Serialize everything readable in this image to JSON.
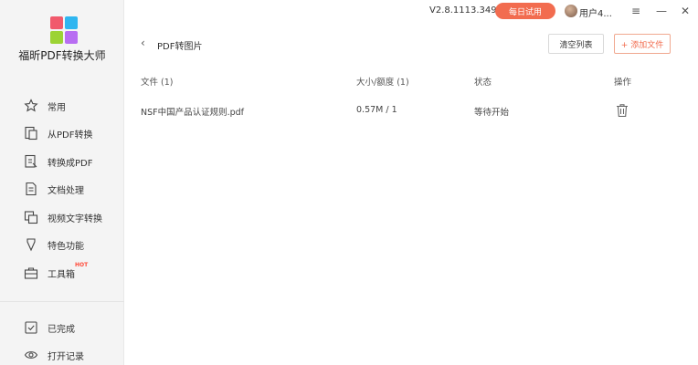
{
  "app": {
    "brand": "福昕PDF转换大师",
    "version": "V2.8.1113.349",
    "trial_button": "每日试用",
    "user_name": "用户4..."
  },
  "window_controls": {
    "menu": "≡",
    "minimize": "—",
    "close": "✕"
  },
  "sidebar": {
    "items": [
      {
        "label": "常用",
        "icon": "star-icon"
      },
      {
        "label": "从PDF转换",
        "icon": "from-pdf-icon"
      },
      {
        "label": "转换成PDF",
        "icon": "to-pdf-icon"
      },
      {
        "label": "文档处理",
        "icon": "document-icon"
      },
      {
        "label": "视频文字转换",
        "icon": "video-text-icon"
      },
      {
        "label": "特色功能",
        "icon": "feature-icon"
      },
      {
        "label": "工具箱",
        "icon": "toolbox-icon",
        "badge": "HOT"
      }
    ],
    "bottom_items": [
      {
        "label": "已完成",
        "icon": "check-icon"
      },
      {
        "label": "打开记录",
        "icon": "eye-icon"
      }
    ]
  },
  "header": {
    "back": "‹",
    "title": "PDF转图片",
    "clear_button": "清空列表",
    "add_button": "+ 添加文件"
  },
  "table": {
    "columns": [
      "文件 (1)",
      "大小/额度 (1)",
      "状态",
      "操作"
    ],
    "rows": [
      {
        "file": "NSF中国产品认证规则.pdf",
        "size": "0.57M / 1",
        "status": "等待开始",
        "action": "delete-icon"
      }
    ]
  },
  "colors": {
    "accent": "#f26c4f",
    "sidebar_bg": "#f4f4f4"
  }
}
